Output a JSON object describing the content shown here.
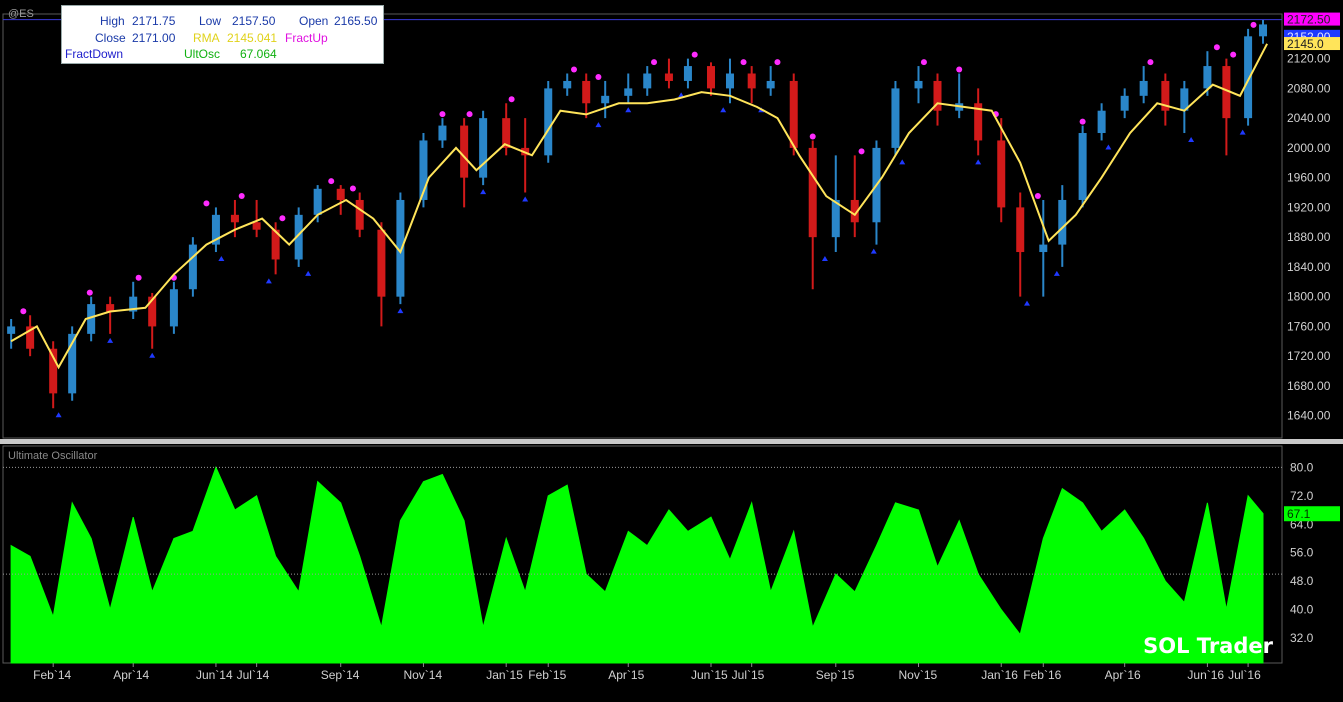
{
  "symbol": "@ES",
  "info_box": {
    "high_label": "High",
    "high_value": "2171.75",
    "low_label": "Low",
    "low_value": "2157.50",
    "open_label": "Open",
    "open_value": "2165.50",
    "close_label": "Close",
    "close_value": "2171.00",
    "rma_label": "RMA",
    "rma_value": "2145.041",
    "fractup_label": "FractUp",
    "fractdown_label": "FractDown",
    "ultosc_label": "UltOsc",
    "ultosc_value": "67.064"
  },
  "watermark": "SOL Trader",
  "colors": {
    "background": "#000000",
    "up_bar": "#2a86c9",
    "down_bar": "#d21a1a",
    "rma_line": "#ffe45a",
    "fractal_up": "#ff2bff",
    "fractal_down": "#1f39ff",
    "oscillator_fill": "#00ff00",
    "last_price_tag": "#ff00ff"
  },
  "chart_data": [
    {
      "type": "line",
      "name": "price-pane",
      "series": [
        {
          "name": "RMA",
          "x": [
            "2014-01-01",
            "2014-01-20",
            "2014-02-05",
            "2014-02-25",
            "2014-03-15",
            "2014-04-10",
            "2014-05-01",
            "2014-05-25",
            "2014-06-15",
            "2014-07-05",
            "2014-07-25",
            "2014-08-15",
            "2014-09-05",
            "2014-09-25",
            "2014-10-15",
            "2014-11-05",
            "2014-11-25",
            "2014-12-10",
            "2014-12-31",
            "2015-01-20",
            "2015-02-10",
            "2015-03-01",
            "2015-03-25",
            "2015-04-15",
            "2015-05-05",
            "2015-05-25",
            "2015-06-15",
            "2015-07-05",
            "2015-07-20",
            "2015-08-05",
            "2015-08-25",
            "2015-09-15",
            "2015-10-05",
            "2015-10-25",
            "2015-11-15",
            "2015-12-05",
            "2015-12-25",
            "2016-01-15",
            "2016-02-05",
            "2016-02-25",
            "2016-03-15",
            "2016-04-05",
            "2016-04-25",
            "2016-05-15",
            "2016-06-05",
            "2016-06-25",
            "2016-07-15"
          ],
          "y": [
            1740,
            1760,
            1705,
            1770,
            1780,
            1785,
            1830,
            1870,
            1890,
            1905,
            1870,
            1910,
            1930,
            1905,
            1860,
            1960,
            2000,
            1970,
            2005,
            1990,
            2050,
            2045,
            2060,
            2060,
            2065,
            2075,
            2070,
            2055,
            2040,
            1990,
            1935,
            1910,
            1960,
            2020,
            2060,
            2055,
            2050,
            1980,
            1875,
            1910,
            1960,
            2020,
            2060,
            2050,
            2085,
            2070,
            2140
          ]
        }
      ],
      "candles": [
        {
          "x": "2014-01-01",
          "o": 1750,
          "h": 1770,
          "l": 1730,
          "c": 1760
        },
        {
          "x": "2014-01-15",
          "o": 1760,
          "h": 1775,
          "l": 1720,
          "c": 1730
        },
        {
          "x": "2014-02-01",
          "o": 1730,
          "h": 1740,
          "l": 1650,
          "c": 1670
        },
        {
          "x": "2014-02-15",
          "o": 1670,
          "h": 1760,
          "l": 1660,
          "c": 1750
        },
        {
          "x": "2014-03-01",
          "o": 1750,
          "h": 1800,
          "l": 1740,
          "c": 1790
        },
        {
          "x": "2014-03-15",
          "o": 1790,
          "h": 1800,
          "l": 1750,
          "c": 1780
        },
        {
          "x": "2014-04-01",
          "o": 1780,
          "h": 1820,
          "l": 1770,
          "c": 1800
        },
        {
          "x": "2014-04-15",
          "o": 1800,
          "h": 1805,
          "l": 1730,
          "c": 1760
        },
        {
          "x": "2014-05-01",
          "o": 1760,
          "h": 1820,
          "l": 1750,
          "c": 1810
        },
        {
          "x": "2014-05-15",
          "o": 1810,
          "h": 1880,
          "l": 1800,
          "c": 1870
        },
        {
          "x": "2014-06-01",
          "o": 1870,
          "h": 1920,
          "l": 1860,
          "c": 1910
        },
        {
          "x": "2014-06-15",
          "o": 1910,
          "h": 1930,
          "l": 1880,
          "c": 1900
        },
        {
          "x": "2014-07-01",
          "o": 1900,
          "h": 1930,
          "l": 1880,
          "c": 1890
        },
        {
          "x": "2014-07-15",
          "o": 1890,
          "h": 1900,
          "l": 1830,
          "c": 1850
        },
        {
          "x": "2014-08-01",
          "o": 1850,
          "h": 1920,
          "l": 1840,
          "c": 1910
        },
        {
          "x": "2014-08-15",
          "o": 1910,
          "h": 1950,
          "l": 1900,
          "c": 1945
        },
        {
          "x": "2014-09-01",
          "o": 1945,
          "h": 1950,
          "l": 1910,
          "c": 1930
        },
        {
          "x": "2014-09-15",
          "o": 1930,
          "h": 1940,
          "l": 1880,
          "c": 1890
        },
        {
          "x": "2014-10-01",
          "o": 1890,
          "h": 1900,
          "l": 1760,
          "c": 1800
        },
        {
          "x": "2014-10-15",
          "o": 1800,
          "h": 1940,
          "l": 1790,
          "c": 1930
        },
        {
          "x": "2014-11-01",
          "o": 1930,
          "h": 2020,
          "l": 1920,
          "c": 2010
        },
        {
          "x": "2014-11-15",
          "o": 2010,
          "h": 2040,
          "l": 2000,
          "c": 2030
        },
        {
          "x": "2014-12-01",
          "o": 2030,
          "h": 2040,
          "l": 1920,
          "c": 1960
        },
        {
          "x": "2014-12-15",
          "o": 1960,
          "h": 2050,
          "l": 1950,
          "c": 2040
        },
        {
          "x": "2015-01-01",
          "o": 2040,
          "h": 2060,
          "l": 1990,
          "c": 2000
        },
        {
          "x": "2015-01-15",
          "o": 2000,
          "h": 2040,
          "l": 1940,
          "c": 1990
        },
        {
          "x": "2015-02-01",
          "o": 1990,
          "h": 2090,
          "l": 1980,
          "c": 2080
        },
        {
          "x": "2015-02-15",
          "o": 2080,
          "h": 2100,
          "l": 2070,
          "c": 2090
        },
        {
          "x": "2015-03-01",
          "o": 2090,
          "h": 2100,
          "l": 2040,
          "c": 2060
        },
        {
          "x": "2015-03-15",
          "o": 2060,
          "h": 2090,
          "l": 2040,
          "c": 2070
        },
        {
          "x": "2015-04-01",
          "o": 2070,
          "h": 2100,
          "l": 2060,
          "c": 2080
        },
        {
          "x": "2015-04-15",
          "o": 2080,
          "h": 2110,
          "l": 2070,
          "c": 2100
        },
        {
          "x": "2015-05-01",
          "o": 2100,
          "h": 2120,
          "l": 2080,
          "c": 2090
        },
        {
          "x": "2015-05-15",
          "o": 2090,
          "h": 2120,
          "l": 2080,
          "c": 2110
        },
        {
          "x": "2015-06-01",
          "o": 2110,
          "h": 2115,
          "l": 2070,
          "c": 2080
        },
        {
          "x": "2015-06-15",
          "o": 2080,
          "h": 2120,
          "l": 2060,
          "c": 2100
        },
        {
          "x": "2015-07-01",
          "o": 2100,
          "h": 2110,
          "l": 2060,
          "c": 2080
        },
        {
          "x": "2015-07-15",
          "o": 2080,
          "h": 2110,
          "l": 2070,
          "c": 2090
        },
        {
          "x": "2015-08-01",
          "o": 2090,
          "h": 2100,
          "l": 1990,
          "c": 2000
        },
        {
          "x": "2015-08-15",
          "o": 2000,
          "h": 2010,
          "l": 1810,
          "c": 1880
        },
        {
          "x": "2015-09-01",
          "o": 1880,
          "h": 1990,
          "l": 1860,
          "c": 1930
        },
        {
          "x": "2015-09-15",
          "o": 1930,
          "h": 1990,
          "l": 1880,
          "c": 1900
        },
        {
          "x": "2015-10-01",
          "o": 1900,
          "h": 2010,
          "l": 1870,
          "c": 2000
        },
        {
          "x": "2015-10-15",
          "o": 2000,
          "h": 2090,
          "l": 1990,
          "c": 2080
        },
        {
          "x": "2015-11-01",
          "o": 2080,
          "h": 2110,
          "l": 2060,
          "c": 2090
        },
        {
          "x": "2015-11-15",
          "o": 2090,
          "h": 2100,
          "l": 2030,
          "c": 2050
        },
        {
          "x": "2015-12-01",
          "o": 2050,
          "h": 2100,
          "l": 2040,
          "c": 2060
        },
        {
          "x": "2015-12-15",
          "o": 2060,
          "h": 2080,
          "l": 1990,
          "c": 2010
        },
        {
          "x": "2016-01-01",
          "o": 2010,
          "h": 2040,
          "l": 1900,
          "c": 1920
        },
        {
          "x": "2016-01-15",
          "o": 1920,
          "h": 1940,
          "l": 1800,
          "c": 1860
        },
        {
          "x": "2016-02-01",
          "o": 1860,
          "h": 1930,
          "l": 1800,
          "c": 1870
        },
        {
          "x": "2016-02-15",
          "o": 1870,
          "h": 1950,
          "l": 1840,
          "c": 1930
        },
        {
          "x": "2016-03-01",
          "o": 1930,
          "h": 2030,
          "l": 1920,
          "c": 2020
        },
        {
          "x": "2016-03-15",
          "o": 2020,
          "h": 2060,
          "l": 2010,
          "c": 2050
        },
        {
          "x": "2016-04-01",
          "o": 2050,
          "h": 2080,
          "l": 2040,
          "c": 2070
        },
        {
          "x": "2016-04-15",
          "o": 2070,
          "h": 2110,
          "l": 2060,
          "c": 2090
        },
        {
          "x": "2016-05-01",
          "o": 2090,
          "h": 2100,
          "l": 2030,
          "c": 2050
        },
        {
          "x": "2016-05-15",
          "o": 2050,
          "h": 2090,
          "l": 2020,
          "c": 2080
        },
        {
          "x": "2016-06-01",
          "o": 2080,
          "h": 2130,
          "l": 2070,
          "c": 2110
        },
        {
          "x": "2016-06-15",
          "o": 2110,
          "h": 2120,
          "l": 1990,
          "c": 2040
        },
        {
          "x": "2016-07-01",
          "o": 2040,
          "h": 2160,
          "l": 2030,
          "c": 2150
        },
        {
          "x": "2016-07-12",
          "o": 2150,
          "h": 2172,
          "l": 2140,
          "c": 2166
        }
      ],
      "fractal_up": [
        "2014-01-10",
        "2014-02-28",
        "2014-04-05",
        "2014-05-01",
        "2014-05-25",
        "2014-06-20",
        "2014-07-20",
        "2014-08-25",
        "2014-09-10",
        "2014-11-15",
        "2014-12-05",
        "2015-01-05",
        "2015-02-20",
        "2015-03-10",
        "2015-04-20",
        "2015-05-20",
        "2015-06-25",
        "2015-07-20",
        "2015-08-15",
        "2015-09-20",
        "2015-11-05",
        "2015-12-01",
        "2015-12-28",
        "2016-01-28",
        "2016-03-01",
        "2016-04-20",
        "2016-06-08",
        "2016-06-20",
        "2016-07-05"
      ],
      "fractal_down": [
        "2014-02-05",
        "2014-03-15",
        "2014-04-15",
        "2014-06-05",
        "2014-07-10",
        "2014-08-08",
        "2014-10-15",
        "2014-12-15",
        "2015-01-15",
        "2015-03-10",
        "2015-04-01",
        "2015-05-10",
        "2015-06-10",
        "2015-07-08",
        "2015-08-24",
        "2015-09-29",
        "2015-10-20",
        "2015-12-15",
        "2016-01-20",
        "2016-02-11",
        "2016-03-20",
        "2016-05-20",
        "2016-06-27"
      ],
      "y_ticks": [
        "1640.00",
        "1680.00",
        "1720.00",
        "1760.00",
        "1800.00",
        "1840.00",
        "1880.00",
        "1920.00",
        "1960.00",
        "2000.00",
        "2040.00",
        "2080.00",
        "2120.00"
      ],
      "ylim": [
        1610,
        2180
      ],
      "grid": false,
      "last_price_tags": [
        "2172.50",
        "2152.00",
        "2145.0"
      ]
    },
    {
      "type": "area",
      "title": "Ultimate Oscillator",
      "series": [
        {
          "name": "UltOsc",
          "x": [
            "2014-01-01",
            "2014-01-15",
            "2014-02-01",
            "2014-02-15",
            "2014-03-01",
            "2014-03-15",
            "2014-04-01",
            "2014-04-15",
            "2014-05-01",
            "2014-05-15",
            "2014-06-01",
            "2014-06-15",
            "2014-07-01",
            "2014-07-15",
            "2014-08-01",
            "2014-08-15",
            "2014-09-01",
            "2014-09-15",
            "2014-10-01",
            "2014-10-15",
            "2014-11-01",
            "2014-11-15",
            "2014-12-01",
            "2014-12-15",
            "2015-01-01",
            "2015-01-15",
            "2015-02-01",
            "2015-02-15",
            "2015-03-01",
            "2015-03-15",
            "2015-04-01",
            "2015-04-15",
            "2015-05-01",
            "2015-05-15",
            "2015-06-01",
            "2015-06-15",
            "2015-07-01",
            "2015-07-15",
            "2015-08-01",
            "2015-08-15",
            "2015-09-01",
            "2015-09-15",
            "2015-10-01",
            "2015-10-15",
            "2015-11-01",
            "2015-11-15",
            "2015-12-01",
            "2015-12-15",
            "2016-01-01",
            "2016-01-15",
            "2016-02-01",
            "2016-02-15",
            "2016-03-01",
            "2016-03-15",
            "2016-04-01",
            "2016-04-15",
            "2016-05-01",
            "2016-05-15",
            "2016-06-01",
            "2016-06-15",
            "2016-07-01",
            "2016-07-12"
          ],
          "y": [
            58,
            55,
            38,
            70,
            60,
            40,
            66,
            45,
            60,
            62,
            80,
            68,
            72,
            55,
            45,
            76,
            70,
            55,
            35,
            65,
            76,
            78,
            65,
            35,
            60,
            45,
            72,
            75,
            50,
            45,
            62,
            58,
            68,
            62,
            66,
            54,
            70,
            45,
            62,
            35,
            50,
            45,
            58,
            70,
            68,
            52,
            65,
            50,
            40,
            33,
            60,
            74,
            70,
            62,
            68,
            60,
            48,
            42,
            70,
            40,
            72,
            67
          ]
        }
      ],
      "y_ticks": [
        "32.0",
        "40.0",
        "48.0",
        "56.0",
        "64.0",
        "72.0",
        "80.0"
      ],
      "ylim": [
        25,
        86
      ],
      "reference_lines": [
        50,
        80
      ],
      "last_value_tag": "67.1"
    }
  ],
  "x_ticks": [
    {
      "label": "Feb`14",
      "date": "2014-02-01"
    },
    {
      "label": "Apr`14",
      "date": "2014-04-01"
    },
    {
      "label": "Jun`14",
      "date": "2014-06-01"
    },
    {
      "label": "Jul`14",
      "date": "2014-07-01"
    },
    {
      "label": "Sep`14",
      "date": "2014-09-01"
    },
    {
      "label": "Nov`14",
      "date": "2014-11-01"
    },
    {
      "label": "Jan`15",
      "date": "2015-01-01"
    },
    {
      "label": "Feb`15",
      "date": "2015-02-01"
    },
    {
      "label": "Apr`15",
      "date": "2015-04-01"
    },
    {
      "label": "Jun`15",
      "date": "2015-06-01"
    },
    {
      "label": "Jul`15",
      "date": "2015-07-01"
    },
    {
      "label": "Sep`15",
      "date": "2015-09-01"
    },
    {
      "label": "Nov`15",
      "date": "2015-11-01"
    },
    {
      "label": "Jan`16",
      "date": "2016-01-01"
    },
    {
      "label": "Feb`16",
      "date": "2016-02-01"
    },
    {
      "label": "Apr`16",
      "date": "2016-04-01"
    },
    {
      "label": "Jun`16",
      "date": "2016-06-01"
    },
    {
      "label": "Jul`16",
      "date": "2016-07-01"
    }
  ]
}
